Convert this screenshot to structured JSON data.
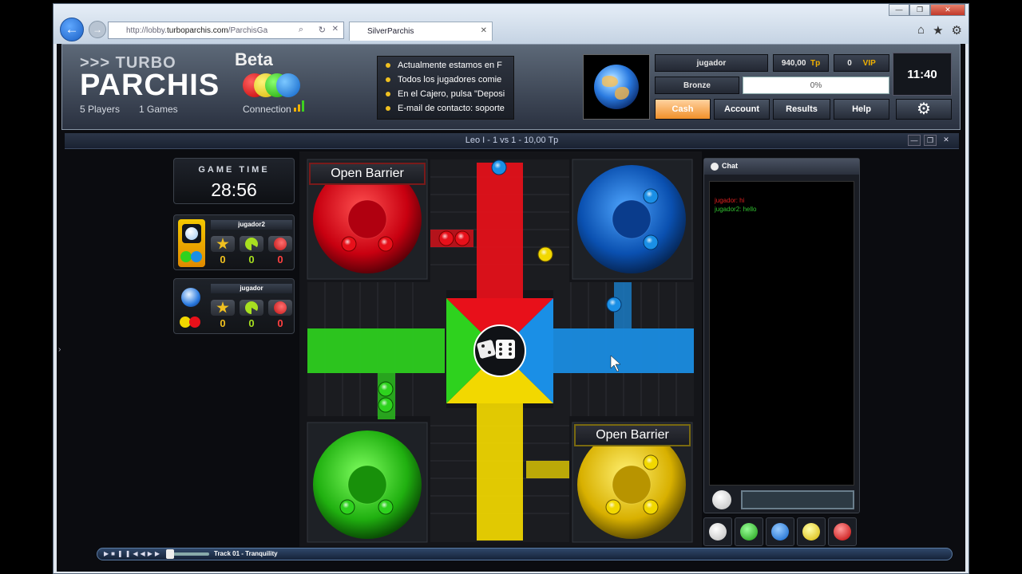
{
  "browser": {
    "url_prefix": "http://lobby.",
    "url_host": "turboparchis.com",
    "url_rest": "/ParchisGa",
    "tab_title": "SilverParchis",
    "window_controls": [
      "—",
      "❐",
      "✕"
    ]
  },
  "header": {
    "logo_top": ">>> TURBO",
    "logo_main": "PARCHIS",
    "beta": "Beta",
    "players": "5 Players",
    "games": "1 Games",
    "connection": "Connection",
    "news": [
      "Actualmente estamos en F",
      "Todos los jugadores comie",
      "En el Cajero, pulsa \"Deposi",
      "E-mail de contacto: soporte"
    ],
    "username": "jugador",
    "balance": "940,00",
    "balance_unit": "Tp",
    "vip_points": "0",
    "vip_label": "VIP",
    "rank": "Bronze",
    "progress_text": "0%",
    "progress_value": 0,
    "clock": "11:40",
    "buttons": [
      "Cash",
      "Account",
      "Results",
      "Help"
    ]
  },
  "game": {
    "title": "Leo I - 1 vs 1 - 10,00 Tp",
    "time_label": "GAME TIME",
    "time_value": "28:56",
    "players": [
      {
        "name": "jugador2",
        "stats": [
          "0",
          "0",
          "0"
        ]
      },
      {
        "name": "jugador",
        "stats": [
          "0",
          "0",
          "0"
        ]
      }
    ],
    "barrier_label": "Open Barrier",
    "barrier_label_2": "Open Barrier"
  },
  "chat": {
    "title": "Chat",
    "messages": [
      {
        "text": "jugador: hi",
        "color": "#e02020"
      },
      {
        "text": "jugador2: hello",
        "color": "#30c030"
      }
    ]
  },
  "media": {
    "track": "Track 01 - Tranquility",
    "controls": "▶■❚❚◀◀▶▶"
  },
  "colors": {
    "red": "#e8101a",
    "blue": "#1a8fe6",
    "green": "#2ed21e",
    "yellow": "#f2d800"
  }
}
